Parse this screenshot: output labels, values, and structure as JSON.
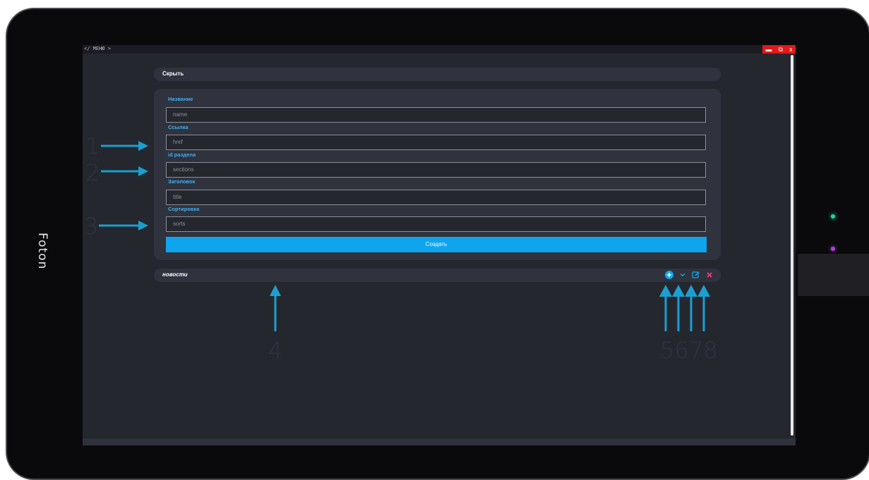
{
  "device": {
    "brand": "Foton"
  },
  "app": {
    "breadcrumb": "</ МЕНЮ >",
    "window_buttons": [
      "minimize",
      "restore",
      "close"
    ]
  },
  "section_toggle": {
    "label": "Скрыть"
  },
  "form": {
    "fields": [
      {
        "label": "Название",
        "placeholder": "name"
      },
      {
        "label": "Ссылка",
        "placeholder": "href"
      },
      {
        "label": "id раздела",
        "placeholder": "sections"
      },
      {
        "label": "Заголовок",
        "placeholder": "title"
      },
      {
        "label": "Сортировка",
        "placeholder": "sorts"
      }
    ],
    "submit_label": "Создать"
  },
  "news_item": {
    "label": "новости",
    "actions": [
      "add-circle-icon",
      "chevron-down-icon",
      "edit-icon",
      "delete-icon"
    ]
  },
  "annotations": {
    "markers": [
      "1",
      "2",
      "3",
      "4",
      "5678"
    ]
  },
  "colors": {
    "accent": "#0ea5ee",
    "label": "#3ab2f5",
    "arrow": "#1a9fd0",
    "delete": "#e8357b",
    "close_button": "#e01919"
  }
}
